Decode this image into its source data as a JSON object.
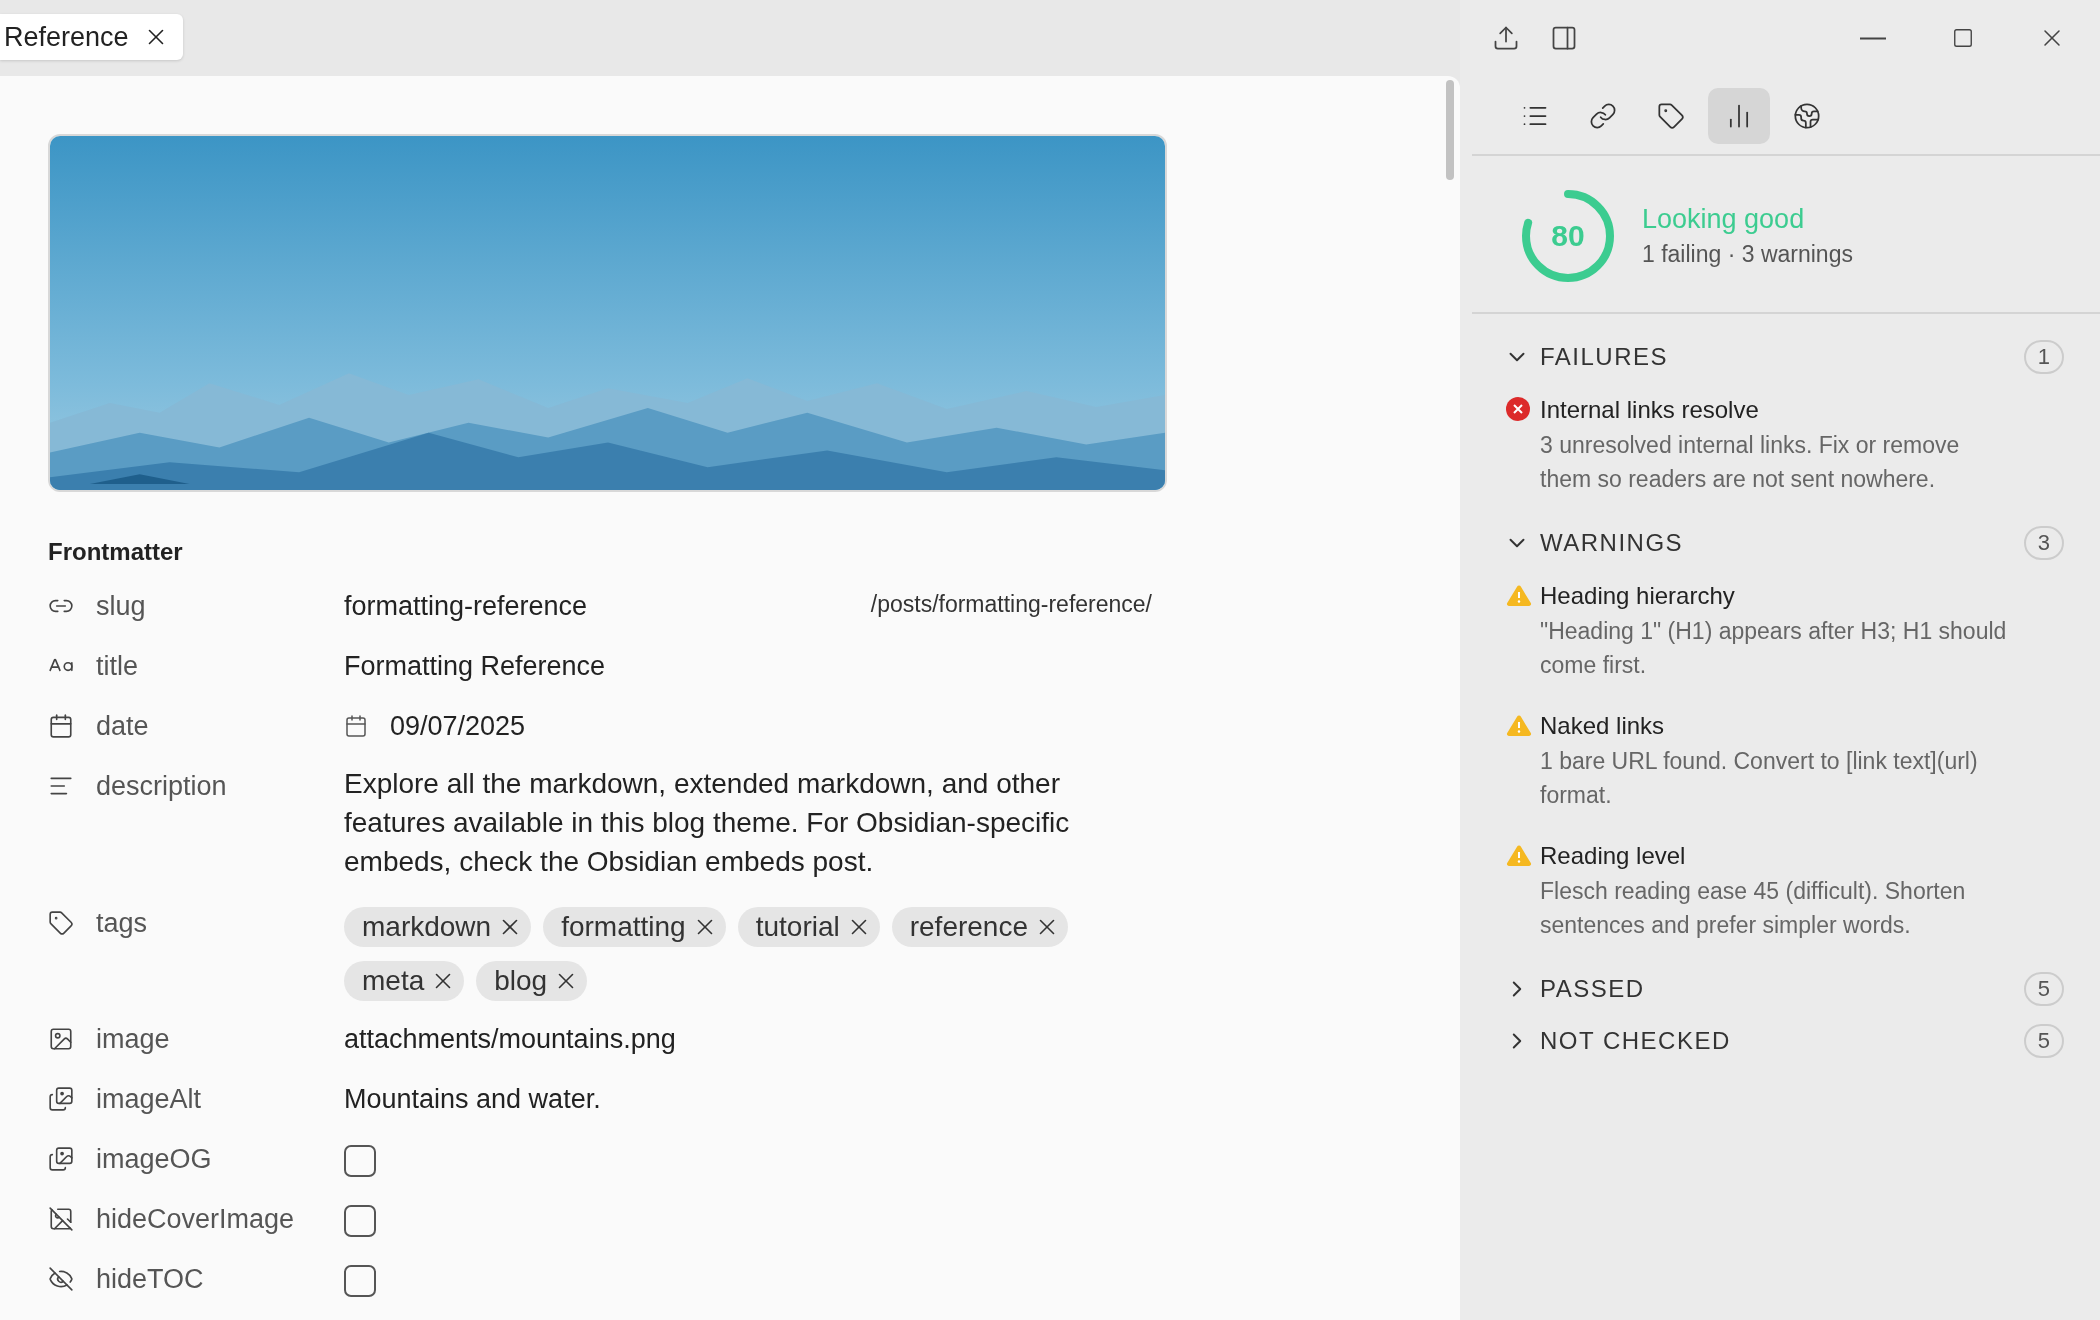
{
  "tab": {
    "title": "Reference"
  },
  "side_tabs": [
    {
      "selected": false
    },
    {
      "selected": false
    },
    {
      "selected": false
    },
    {
      "selected": true
    },
    {
      "selected": false
    }
  ],
  "score": {
    "value": "80",
    "level": 0.8,
    "headline": "Looking good",
    "summary": "1 failing · 3 warnings"
  },
  "sections": [
    {
      "title": "FAILURES",
      "count": "1",
      "expanded": true,
      "items": [
        {
          "kind": "failure",
          "title": "Internal links resolve",
          "detail": "3 unresolved internal links. Fix or remove them so readers are not sent nowhere."
        }
      ]
    },
    {
      "title": "WARNINGS",
      "count": "3",
      "expanded": true,
      "items": [
        {
          "kind": "warning",
          "title": "Heading hierarchy",
          "detail": "\"Heading 1\" (H1) appears after H3; H1 should come first."
        },
        {
          "kind": "warning",
          "title": "Naked links",
          "detail": "1 bare URL found. Convert to [link text](url) format."
        },
        {
          "kind": "warning",
          "title": "Reading level",
          "detail": "Flesch reading ease 45 (difficult). Shorten sentences and prefer simpler words."
        }
      ]
    },
    {
      "title": "PASSED",
      "count": "5",
      "expanded": false
    },
    {
      "title": "NOT CHECKED",
      "count": "5",
      "expanded": false
    }
  ],
  "frontmatter": {
    "heading": "Frontmatter",
    "properties": [
      {
        "kind": "text",
        "name": "slug",
        "value": "formatting-reference",
        "hint": "/posts/formatting-reference/"
      },
      {
        "kind": "text",
        "name": "title",
        "value": "Formatting Reference"
      },
      {
        "kind": "date",
        "name": "date",
        "value": "09/07/2025"
      },
      {
        "kind": "text",
        "name": "description",
        "value": "Explore all the markdown, extended markdown, and other features available in this blog theme. For Obsidian-specific embeds, check the Obsidian embeds post."
      },
      {
        "kind": "tags",
        "name": "tags",
        "tags": [
          "markdown",
          "formatting",
          "tutorial",
          "reference",
          "meta",
          "blog"
        ]
      },
      {
        "kind": "text",
        "name": "image",
        "value": "attachments/mountains.png"
      },
      {
        "kind": "text",
        "name": "imageAlt",
        "value": "Mountains and water."
      },
      {
        "kind": "checkbox",
        "name": "imageOG",
        "checked": false
      },
      {
        "kind": "checkbox",
        "name": "hideCoverImage",
        "checked": false
      },
      {
        "kind": "checkbox",
        "name": "hideTOC",
        "checked": false
      }
    ]
  }
}
